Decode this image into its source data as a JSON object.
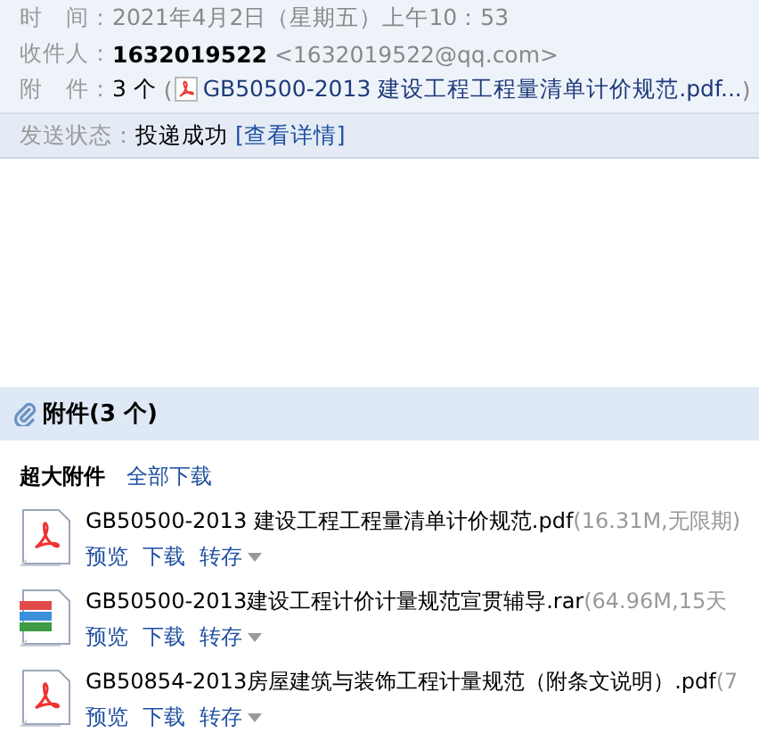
{
  "header": {
    "fields": [
      {
        "kind": "time",
        "label": "时　间：",
        "value": "2021年4月2日（星期五）上午10：53"
      },
      {
        "kind": "recipient",
        "label": "收件人：",
        "name": "1632019522",
        "address": "<1632019522@qq.com>"
      },
      {
        "kind": "attachments",
        "label": "附　件：",
        "count": "3 个",
        "open": "(",
        "file": "GB50500-2013 建设工程工程量清单计价规范.pdf...",
        "close": ")"
      }
    ],
    "status": {
      "label": "发送状态：",
      "value": "投递成功",
      "link": "[查看详情]"
    }
  },
  "attachments": {
    "title": "附件",
    "count": "(3 个)",
    "section": "超大附件",
    "download_all": "全部下载",
    "files": [
      {
        "kind": "pdf",
        "name": "GB50500-2013 建设工程工程量清单计价规范.pdf",
        "meta": "(16.31M,无限期)",
        "actions": [
          "预览",
          "下载",
          "转存"
        ]
      },
      {
        "kind": "rar",
        "name": "GB50500-2013建设工程计价计量规范宣贯辅导.rar",
        "meta": "(64.96M,15天",
        "actions": [
          "预览",
          "下载",
          "转存"
        ]
      },
      {
        "kind": "pdf",
        "name": "GB50854-2013房屋建筑与装饰工程计量规范（附条文说明）.pdf",
        "meta": "(7",
        "actions": [
          "预览",
          "下载",
          "转存"
        ]
      }
    ]
  }
}
